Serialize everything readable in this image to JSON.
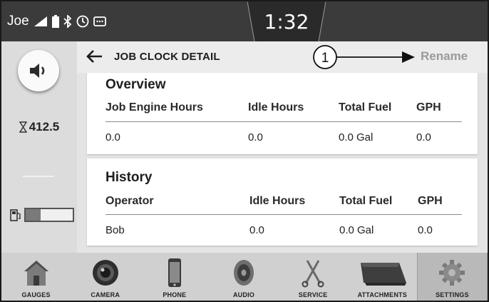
{
  "status_bar": {
    "user": "Joe",
    "time": "1:32"
  },
  "left_rail": {
    "hours": "412.5",
    "fuel_level": 0.32
  },
  "header": {
    "title": "JOB CLOCK DETAIL",
    "rename_label": "Rename",
    "callout_number": "1"
  },
  "overview": {
    "title": "Overview",
    "columns": [
      "Job Engine Hours",
      "Idle Hours",
      "Total Fuel",
      "GPH"
    ],
    "row": [
      "0.0",
      "0.0",
      "0.0 Gal",
      "0.0"
    ]
  },
  "history": {
    "title": "History",
    "columns": [
      "Operator",
      "Idle Hours",
      "Total Fuel",
      "GPH"
    ],
    "rows": [
      [
        "Bob",
        "0.0",
        "0.0 Gal",
        "0.0"
      ]
    ]
  },
  "dock": {
    "items": [
      {
        "label": "GAUGES",
        "icon": "home-icon"
      },
      {
        "label": "CAMERA",
        "icon": "camera-icon"
      },
      {
        "label": "PHONE",
        "icon": "phone-icon"
      },
      {
        "label": "AUDIO",
        "icon": "speaker-icon"
      },
      {
        "label": "SERVICE",
        "icon": "wrench-icon"
      },
      {
        "label": "ATTACHMENTS",
        "icon": "bucket-icon"
      },
      {
        "label": "SETTINGS",
        "icon": "gear-icon"
      }
    ],
    "active_index": 6
  }
}
